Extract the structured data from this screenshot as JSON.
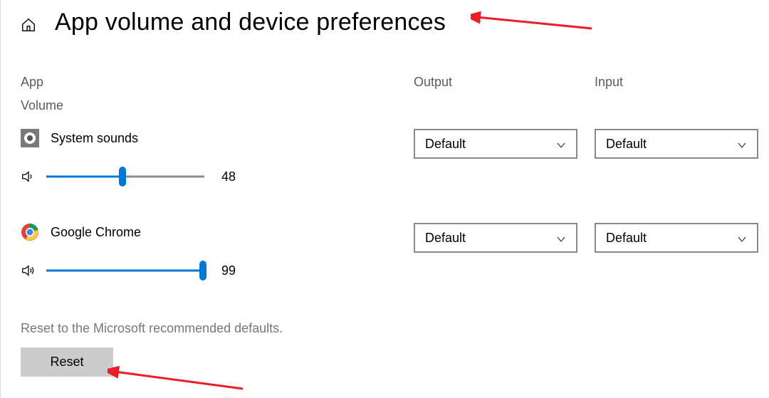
{
  "header": {
    "title": "App volume and device preferences"
  },
  "columns": {
    "app": "App",
    "output": "Output",
    "input": "Input",
    "volume": "Volume"
  },
  "apps": [
    {
      "name": "System sounds",
      "icon": "speaker-tile-icon",
      "volume": 48,
      "output": "Default",
      "input": "Default"
    },
    {
      "name": "Google Chrome",
      "icon": "chrome-icon",
      "volume": 99,
      "output": "Default",
      "input": "Default"
    }
  ],
  "footer": {
    "description": "Reset to the Microsoft recommended defaults.",
    "reset_label": "Reset"
  }
}
